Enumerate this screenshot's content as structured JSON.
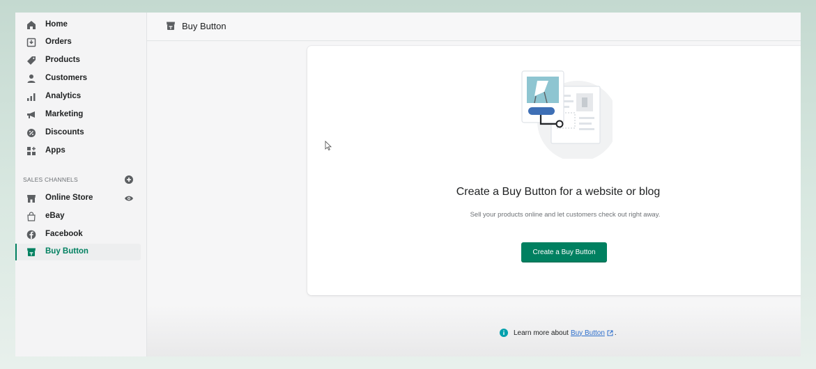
{
  "sidebar": {
    "items": [
      {
        "label": "Home",
        "icon": "home-icon"
      },
      {
        "label": "Orders",
        "icon": "orders-icon"
      },
      {
        "label": "Products",
        "icon": "tag-icon"
      },
      {
        "label": "Customers",
        "icon": "person-icon"
      },
      {
        "label": "Analytics",
        "icon": "bar-chart-icon"
      },
      {
        "label": "Marketing",
        "icon": "megaphone-icon"
      },
      {
        "label": "Discounts",
        "icon": "discount-icon"
      },
      {
        "label": "Apps",
        "icon": "apps-icon"
      }
    ],
    "sales_channels_title": "SALES CHANNELS",
    "channels": [
      {
        "label": "Online Store",
        "icon": "store-icon"
      },
      {
        "label": "eBay",
        "icon": "shopping-bag-icon"
      },
      {
        "label": "Facebook",
        "icon": "facebook-icon"
      },
      {
        "label": "Buy Button",
        "icon": "buy-button-icon",
        "active": true
      }
    ]
  },
  "header": {
    "title": "Buy Button"
  },
  "card": {
    "title": "Create a Buy Button for a website or blog",
    "subtitle": "Sell your products online and let customers check out right away.",
    "button_label": "Create a Buy Button"
  },
  "footer": {
    "prefix": "Learn more about",
    "link": "Buy Button",
    "suffix": "."
  },
  "colors": {
    "accent": "#008060",
    "link": "#2c6ecb",
    "info": "#00a0ac"
  }
}
